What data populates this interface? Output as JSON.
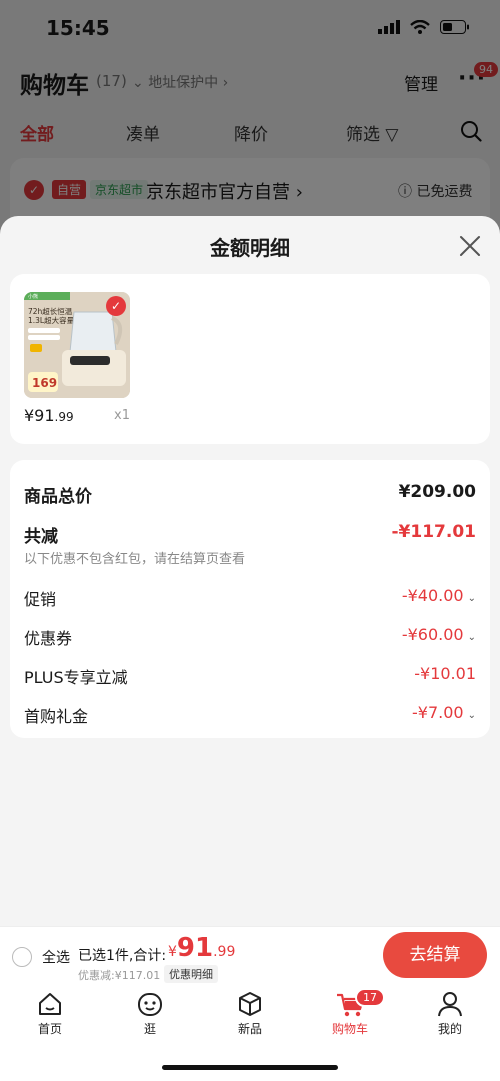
{
  "status": {
    "time": "15:45"
  },
  "cart_header": {
    "title": "购物车",
    "count": "(17)",
    "address_protect": "地址保护中",
    "manage": "管理",
    "more_badge": "94"
  },
  "filters": [
    "全部",
    "凑单",
    "降价",
    "筛选"
  ],
  "store": {
    "self_tag": "自营",
    "super_tag": "京东超市",
    "name": "京东超市官方自营",
    "shipping": "已免运费"
  },
  "sheet": {
    "title": "金额明细",
    "product": {
      "price_int": "¥91",
      "price_dec": ".99",
      "qty": "x1",
      "image_text_1": "72h超长恒温",
      "image_text_2": "1.3L超大容量",
      "image_price": "169",
      "image_brand": "小熊"
    },
    "rows": {
      "total_label": "商品总价",
      "total_value": "¥209.00",
      "reduce_label": "共减",
      "reduce_value": "-¥117.01",
      "note": "以下优惠不包含红包，请在结算页查看",
      "promo_label": "促销",
      "promo_value": "-¥40.00",
      "coupon_label": "优惠券",
      "coupon_value": "-¥60.00",
      "plus_label": "PLUS专享立减",
      "plus_value": "-¥10.01",
      "gift_label": "首购礼金",
      "gift_value": "-¥7.00"
    }
  },
  "checkout": {
    "select_all": "全选",
    "selected_text": "已选1件,合计:",
    "currency": "¥",
    "total_int": "91",
    "total_dec": ".99",
    "discount": "优惠减:¥117.01",
    "detail_link": "优惠明细",
    "button": "去结算"
  },
  "tabbar": {
    "items": [
      {
        "label": "首页"
      },
      {
        "label": "逛"
      },
      {
        "label": "新品"
      },
      {
        "label": "购物车"
      },
      {
        "label": "我的"
      }
    ],
    "cart_badge": "17"
  },
  "colors": {
    "accent": "#e4393c",
    "checkout_button": "#e84a3f"
  }
}
